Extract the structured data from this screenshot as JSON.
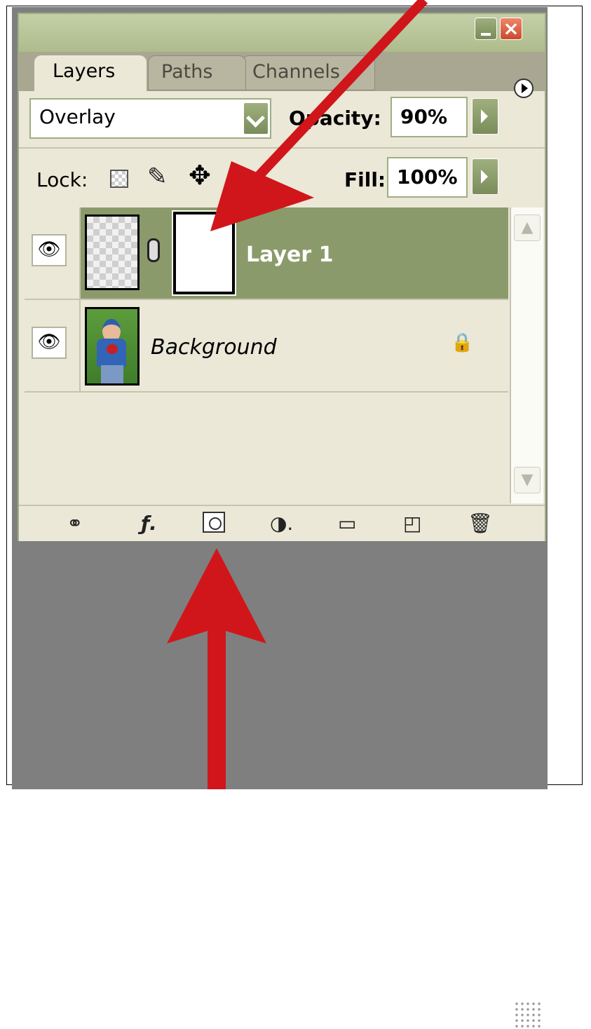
{
  "panel": {
    "tabs": [
      {
        "label": "Layers",
        "active": true
      },
      {
        "label": "Paths",
        "active": false
      },
      {
        "label": "Channels",
        "active": false
      }
    ],
    "blend_mode": "Overlay",
    "opacity_label": "Opacity:",
    "opacity_value": "90%",
    "lock_label": "Lock:",
    "fill_label": "Fill:",
    "fill_value": "100%",
    "layers": [
      {
        "name": "Layer 1",
        "selected": true,
        "visible": true,
        "has_mask": true
      },
      {
        "name": "Background",
        "selected": false,
        "visible": true,
        "locked": true
      }
    ]
  },
  "icons": {
    "minimize": "minimize-icon",
    "close": "close-icon",
    "menu": "panel-menu-icon",
    "visibility": "eye-icon",
    "lock": "lock-icon",
    "bottom": [
      "link-layers-icon",
      "layer-style-icon",
      "add-mask-icon",
      "adjustment-layer-icon",
      "new-group-icon",
      "new-layer-icon",
      "delete-layer-icon"
    ]
  },
  "colors": {
    "panel_bg": "#ebe8d8",
    "selected_row": "#8b9a6a",
    "accent": "#9fad84",
    "canvas": "#7f7f7f",
    "arrow": "#d0161a"
  }
}
